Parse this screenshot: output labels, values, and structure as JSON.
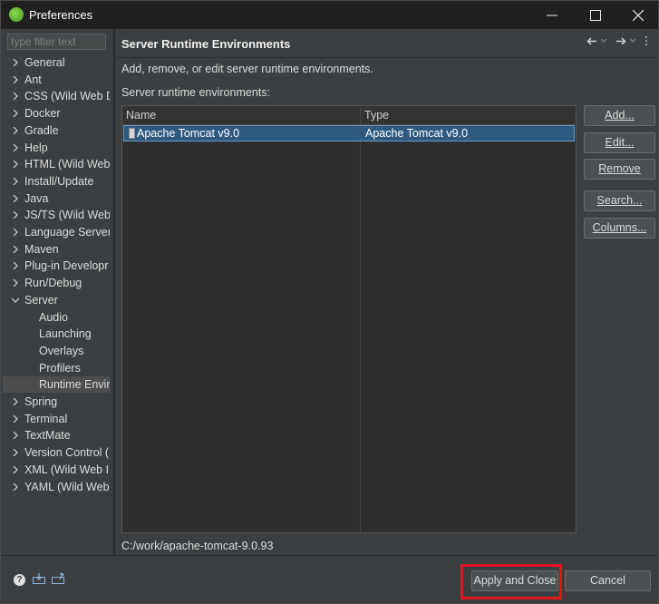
{
  "window": {
    "title": "Preferences"
  },
  "nav": {
    "filter_placeholder": "type filter text",
    "items": [
      {
        "label": "General",
        "expandable": true
      },
      {
        "label": "Ant",
        "expandable": true
      },
      {
        "label": "CSS (Wild Web D",
        "expandable": true
      },
      {
        "label": "Docker",
        "expandable": true
      },
      {
        "label": "Gradle",
        "expandable": true
      },
      {
        "label": "Help",
        "expandable": true
      },
      {
        "label": "HTML (Wild Web",
        "expandable": true
      },
      {
        "label": "Install/Update",
        "expandable": true
      },
      {
        "label": "Java",
        "expandable": true
      },
      {
        "label": "JS/TS (Wild Web",
        "expandable": true
      },
      {
        "label": "Language Server",
        "expandable": true
      },
      {
        "label": "Maven",
        "expandable": true
      },
      {
        "label": "Plug-in Developr",
        "expandable": true
      },
      {
        "label": "Run/Debug",
        "expandable": true
      },
      {
        "label": "Server",
        "expandable": true,
        "expanded": true
      },
      {
        "label": "Audio",
        "child": true
      },
      {
        "label": "Launching",
        "child": true
      },
      {
        "label": "Overlays",
        "child": true
      },
      {
        "label": "Profilers",
        "child": true
      },
      {
        "label": "Runtime Enviro",
        "child": true,
        "selected": true
      },
      {
        "label": "Spring",
        "expandable": true
      },
      {
        "label": "Terminal",
        "expandable": true
      },
      {
        "label": "TextMate",
        "expandable": true
      },
      {
        "label": "Version Control (",
        "expandable": true
      },
      {
        "label": "XML (Wild Web I",
        "expandable": true
      },
      {
        "label": "YAML (Wild Web",
        "expandable": true
      }
    ]
  },
  "page": {
    "title": "Server Runtime Environments",
    "description": "Add, remove, or edit server runtime environments.",
    "list_label": "Server runtime environments:",
    "columns": [
      "Name",
      "Type"
    ],
    "rows": [
      {
        "name": "Apache Tomcat v9.0",
        "type": "Apache Tomcat v9.0",
        "selected": true
      }
    ],
    "side_buttons": [
      "Add...",
      "Edit...",
      "Remove",
      "Search...",
      "Columns..."
    ],
    "status_path": "C:/work/apache-tomcat-9.0.93"
  },
  "footer": {
    "apply_close_label": "Apply and Close",
    "cancel_label": "Cancel"
  },
  "colors": {
    "highlight": "#e0161f",
    "selection": "#2f5a80"
  }
}
